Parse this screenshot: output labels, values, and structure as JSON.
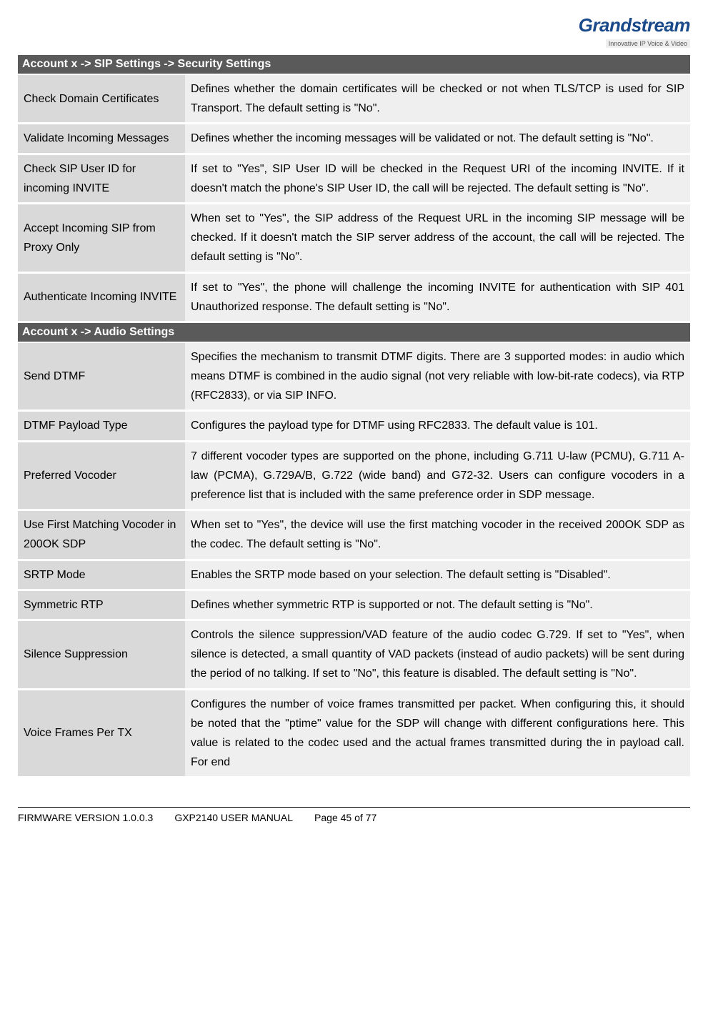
{
  "brand": {
    "name": "Grandstream",
    "tagline": "Innovative IP Voice & Video"
  },
  "sections": [
    {
      "title": "Account x -> SIP Settings -> Security Settings",
      "rows": [
        {
          "label": "Check Domain Certificates",
          "desc": "Defines whether the domain certificates will be checked or not when TLS/TCP is used for SIP Transport. The default setting is \"No\"."
        },
        {
          "label": "Validate Incoming Messages",
          "desc": "Defines whether the incoming messages will be validated or not. The default setting is \"No\"."
        },
        {
          "label": "Check SIP User ID for incoming INVITE",
          "desc": "If set to \"Yes\", SIP User ID will be checked in the Request URI of the incoming INVITE. If it doesn't match the phone's SIP User ID, the call will be rejected. The default setting is \"No\"."
        },
        {
          "label": "Accept Incoming SIP from Proxy Only",
          "desc": "When set to \"Yes\", the SIP address of the Request URL in the incoming SIP message will be checked. If it doesn't match the SIP server address of the account, the call will be rejected. The default setting is \"No\"."
        },
        {
          "label": "Authenticate Incoming INVITE",
          "desc": "If set to \"Yes\", the phone will challenge the incoming INVITE for authentication with SIP 401 Unauthorized response. The default setting is \"No\"."
        }
      ]
    },
    {
      "title": "Account x -> Audio Settings",
      "rows": [
        {
          "label": "Send DTMF",
          "desc": "Specifies the mechanism to transmit DTMF digits. There are 3 supported modes: in audio which means DTMF is combined in the audio signal (not very reliable with low-bit-rate codecs), via RTP (RFC2833), or via SIP INFO."
        },
        {
          "label": "DTMF Payload Type",
          "desc": "Configures the payload type for DTMF using RFC2833. The default value is 101."
        },
        {
          "label": "Preferred Vocoder",
          "desc": "7 different vocoder types are supported on the phone, including G.711 U-law (PCMU), G.711 A-law (PCMA), G.729A/B, G.722 (wide band) and G72-32. Users can configure vocoders in a preference list that is included with the same preference order in SDP message."
        },
        {
          "label": "Use First Matching Vocoder in 200OK SDP",
          "desc": "When set to \"Yes\", the device will use the first matching vocoder in the received 200OK SDP as the codec. The default setting is \"No\"."
        },
        {
          "label": "SRTP Mode",
          "desc": "Enables the SRTP mode based on your selection. The default setting is \"Disabled\"."
        },
        {
          "label": "Symmetric RTP",
          "desc": "Defines whether symmetric RTP is supported or not. The default setting is \"No\"."
        },
        {
          "label": "Silence Suppression",
          "desc": "Controls the silence suppression/VAD feature of the audio codec G.729. If set to \"Yes\", when silence is detected, a small quantity of VAD packets (instead of audio packets) will be sent during the period of no talking. If set to \"No\", this feature is disabled. The default setting is \"No\"."
        },
        {
          "label": "Voice Frames Per TX",
          "desc": "Configures the number of voice frames transmitted per packet. When configuring this, it should be noted that the \"ptime\" value for the SDP will change with different configurations here. This value is related to the codec used and the actual frames transmitted during the in payload call. For end"
        }
      ]
    }
  ],
  "footer": {
    "version": "FIRMWARE VERSION 1.0.0.3",
    "manual": "GXP2140 USER MANUAL",
    "page": "Page 45 of 77"
  }
}
